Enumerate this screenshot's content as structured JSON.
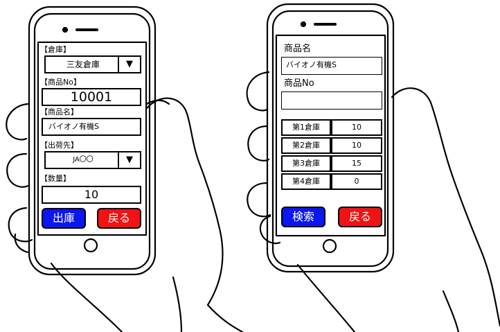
{
  "left_phone": {
    "warehouse_label": "【倉庫】",
    "warehouse_value": "三友倉庫",
    "product_no_label": "【商品No】",
    "product_no_value": "10001",
    "product_name_label": "【商品名】",
    "product_name_value": "バイオノ有機S",
    "destination_label": "【出荷先】",
    "destination_value": "JA〇〇",
    "quantity_label": "【数量】",
    "quantity_value": "10",
    "ship_button": "出庫",
    "back_button": "戻る",
    "dropdown_arrow": "▼"
  },
  "right_phone": {
    "product_name_label": "商品名",
    "product_name_value": "バイオノ有機S",
    "product_no_label": "商品No",
    "product_no_value": "",
    "stock_rows": [
      {
        "warehouse": "第1倉庫",
        "qty": "10"
      },
      {
        "warehouse": "第2倉庫",
        "qty": "10"
      },
      {
        "warehouse": "第3倉庫",
        "qty": "15"
      },
      {
        "warehouse": "第4倉庫",
        "qty": "0"
      }
    ],
    "search_button": "検索",
    "back_button": "戻る"
  },
  "colors": {
    "blue_button": "#0b16f0",
    "red_button": "#f01313"
  }
}
